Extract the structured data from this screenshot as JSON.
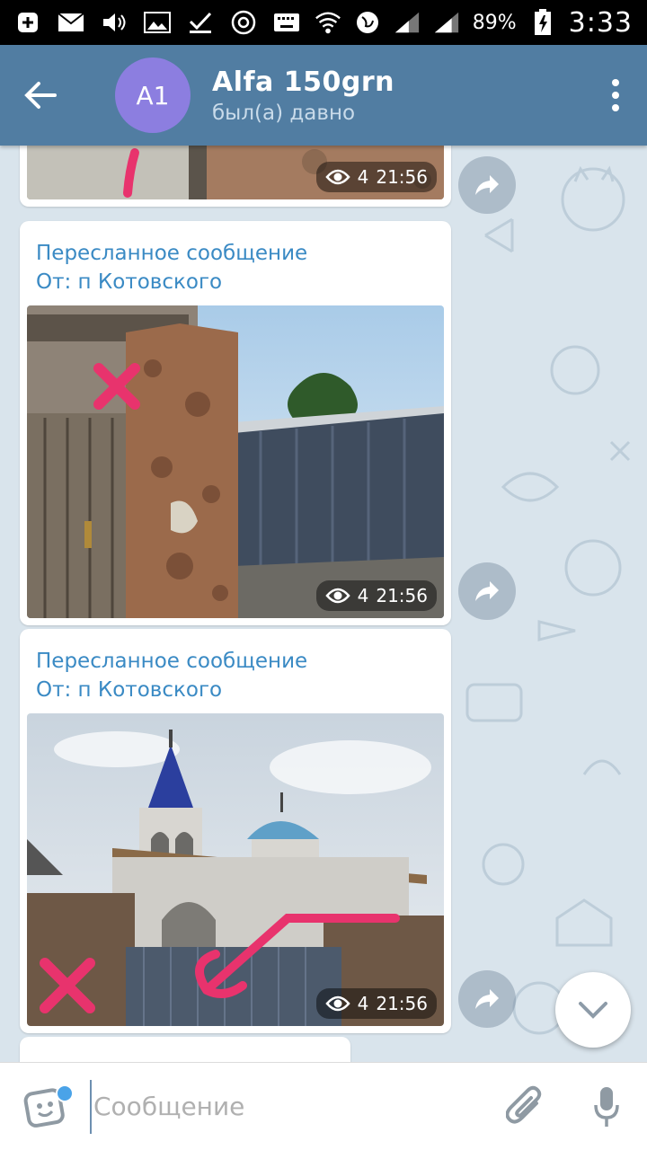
{
  "status_bar": {
    "battery": "89%",
    "time": "3:33",
    "icons": [
      "plus-box-icon",
      "mail-icon",
      "volume-icon",
      "image-icon",
      "checkmark-icon",
      "chrome-icon",
      "keyboard-icon",
      "wifi-icon",
      "globe-icon",
      "signal-icon",
      "signal-icon",
      "battery-icon"
    ]
  },
  "header": {
    "avatar_initials": "A1",
    "avatar_color": "#8c7ee0",
    "title": "Alfa 150grn",
    "status": "был(а) давно",
    "bar_color": "#517da2"
  },
  "messages": [
    {
      "forwarded_label": "",
      "from_label": "",
      "views": "4",
      "time": "21:56"
    },
    {
      "forwarded_label": "Пересланное сообщение",
      "from_label": "От: п Котовского",
      "views": "4",
      "time": "21:56"
    },
    {
      "forwarded_label": "Пересланное сообщение",
      "from_label": "От: п Котовского",
      "views": "4",
      "time": "21:56"
    }
  ],
  "input": {
    "placeholder": "Сообщение"
  },
  "colors": {
    "accent": "#3a8ac4",
    "marker": "#e8336d"
  }
}
